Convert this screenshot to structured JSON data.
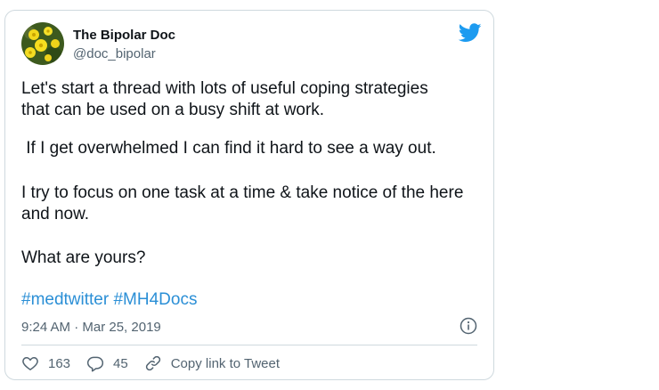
{
  "author": {
    "name": "The Bipolar Doc",
    "handle": "@doc_bipolar"
  },
  "tweet": {
    "paragraphs": [
      "Let's start a thread with lots of useful coping strategies\nthat can be used on a busy shift at work.",
      " If I get overwhelmed I can find it hard to see a way out.",
      "I try to focus on one task at a time & take notice of the here\nand now.",
      "What are yours?"
    ],
    "hashtags": [
      "#medtwitter",
      "#MH4Docs"
    ],
    "timestamp": "9:24 AM · Mar 25, 2019"
  },
  "actions": {
    "likes": "163",
    "replies": "45",
    "copy_link_label": "Copy link to Tweet"
  },
  "icons": {
    "brand": "twitter-bird-icon",
    "info": "info-icon",
    "like": "heart-icon",
    "reply": "reply-icon",
    "copy": "link-icon"
  },
  "colors": {
    "accent": "#1d9bf0",
    "text": "#0f1419",
    "muted": "#536471",
    "border": "#cfd9de"
  }
}
